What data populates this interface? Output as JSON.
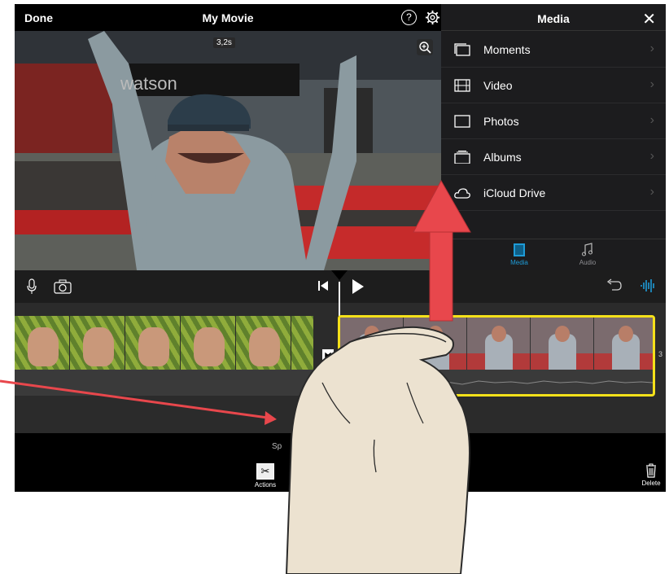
{
  "topbar": {
    "done_label": "Done",
    "title": "My Movie"
  },
  "viewer": {
    "duration": "3,2s"
  },
  "media_panel": {
    "title": "Media",
    "items": [
      {
        "label": "Moments",
        "icon": "moments-icon"
      },
      {
        "label": "Video",
        "icon": "film-icon"
      },
      {
        "label": "Photos",
        "icon": "photo-icon"
      },
      {
        "label": "Albums",
        "icon": "albums-icon"
      },
      {
        "label": "iCloud Drive",
        "icon": "cloud-icon"
      }
    ],
    "tabs": [
      {
        "label": "Media",
        "icon": "media-icon",
        "active": true
      },
      {
        "label": "Audio",
        "icon": "music-note-icon",
        "active": false
      }
    ]
  },
  "timeline": {
    "end_marker": "3"
  },
  "actionbar": {
    "split_label": "Sp",
    "actions_label": "Actions",
    "delete_label": "Delete"
  },
  "colors": {
    "accent": "#1e9bd7",
    "clip_selected": "#f5e11a",
    "annotation_arrow": "#e8474c",
    "hand": "#ece2d0"
  }
}
